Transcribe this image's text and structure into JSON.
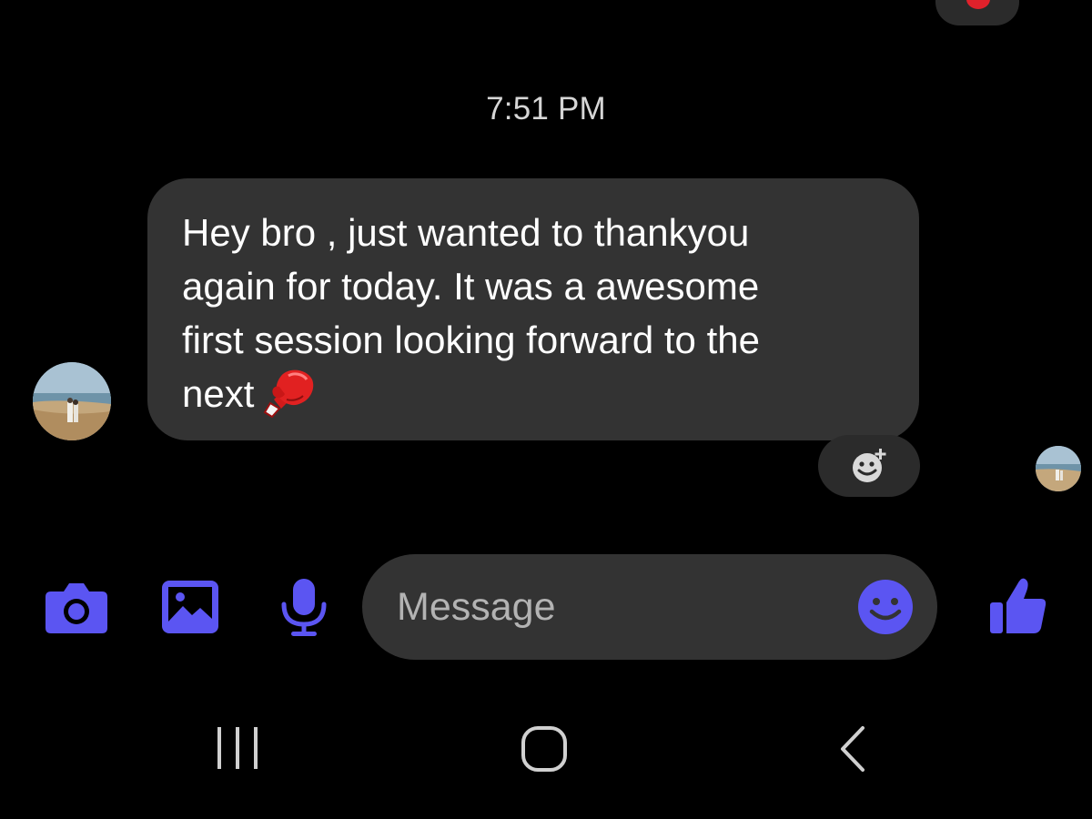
{
  "conversation": {
    "timestamp": "7:51 PM",
    "messages": [
      {
        "sender": "contact",
        "text": "Hey bro , just wanted to thankyou\nagain for today. It was a awesome\nfirst session looking forward to the\nnext",
        "emoji": "boxing-glove-icon"
      }
    ]
  },
  "composer": {
    "placeholder": "Message",
    "accent_color": "#5b55f2"
  },
  "icons": {
    "camera": "camera-icon",
    "gallery": "gallery-icon",
    "mic": "microphone-icon",
    "emoji": "emoji-smiley-icon",
    "like": "thumbs-up-icon",
    "add_reaction": "add-reaction-icon"
  },
  "nav": {
    "recent": "recent-apps-icon",
    "home": "home-icon",
    "back": "back-icon"
  },
  "colors": {
    "background": "#000000",
    "bubble": "#333333",
    "accent": "#5b55f2"
  }
}
